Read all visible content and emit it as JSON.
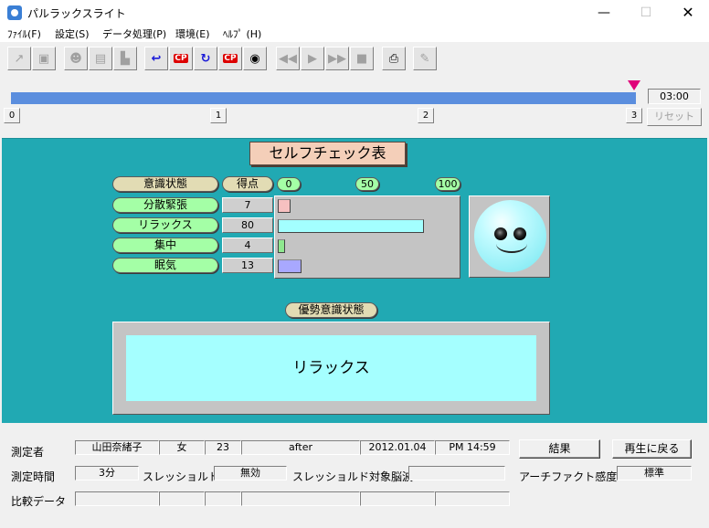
{
  "window": {
    "title": "パルラックスライト",
    "controls": {
      "minimize": "—",
      "maximize": "☐",
      "close": "✕"
    }
  },
  "menu": [
    "ﾌｧｲﾙ(F)",
    "設定(S)",
    "データ処理(P)",
    "環境(E)",
    "ﾍﾙﾌﾟ (H)"
  ],
  "toolbar": {
    "cp_label": "CP",
    "buttons": [
      {
        "name": "open-icon",
        "glyph": "↗",
        "enabled": false
      },
      {
        "name": "save-icon",
        "glyph": "▣",
        "enabled": false
      },
      {
        "name": "user-icon",
        "glyph": "☻",
        "enabled": false
      },
      {
        "name": "monitor-icon",
        "glyph": "▤",
        "enabled": false
      },
      {
        "name": "graph-icon",
        "glyph": "▙",
        "enabled": false
      },
      {
        "name": "return-icon",
        "glyph": "↩",
        "enabled": true
      },
      {
        "name": "cp-record-icon",
        "glyph": "CP",
        "enabled": true
      },
      {
        "name": "refresh-icon",
        "glyph": "↻",
        "enabled": true
      },
      {
        "name": "cp-refresh-icon",
        "glyph": "CP",
        "enabled": true
      },
      {
        "name": "devices-icon",
        "glyph": "◉",
        "enabled": true
      },
      {
        "name": "rewind-icon",
        "glyph": "◀◀",
        "enabled": false
      },
      {
        "name": "play-icon",
        "glyph": "▶",
        "enabled": false
      },
      {
        "name": "fast-forward-icon",
        "glyph": "▶▶",
        "enabled": false
      },
      {
        "name": "stop-icon",
        "glyph": "■",
        "enabled": false
      },
      {
        "name": "print-icon",
        "glyph": "⎙",
        "enabled": true
      },
      {
        "name": "pen-icon",
        "glyph": "✎",
        "enabled": false
      }
    ]
  },
  "timeline": {
    "time": "03:00",
    "markers": [
      "0",
      "1",
      "2",
      "3"
    ],
    "reset_label": "リセット",
    "progress_fraction": 0.98
  },
  "self_check": {
    "title": "セルフチェック表",
    "header_state": "意識状態",
    "header_score": "得点",
    "scale": [
      "0",
      "50",
      "100"
    ],
    "rows": [
      {
        "label": "分散緊張",
        "score": "7",
        "value": 7,
        "color": "#f6c0c0"
      },
      {
        "label": "リラックス",
        "score": "80",
        "value": 80,
        "color": "#a3ffff"
      },
      {
        "label": "集中",
        "score": "4",
        "value": 4,
        "color": "#8fe88f"
      },
      {
        "label": "眠気",
        "score": "13",
        "value": 13,
        "color": "#a8a8ff"
      }
    ],
    "dominant_label": "優勢意識状態",
    "dominant_value": "リラックス"
  },
  "measurement": {
    "measurer_label": "測定者",
    "name": "山田奈緒子",
    "sex": "女",
    "age": "23",
    "condition": "after",
    "date": "2012.01.04",
    "time": "PM 14:59",
    "duration_label": "測定時間",
    "duration": "3分",
    "threshold_label": "スレッショルド",
    "threshold": "無効",
    "threshold_wave_label": "スレッショルド対象脳波",
    "threshold_wave": "",
    "artifact_label": "アーチファクト感度",
    "artifact": "標準",
    "compare_label": "比較データ",
    "result_button": "結果",
    "back_button": "再生に戻る"
  }
}
